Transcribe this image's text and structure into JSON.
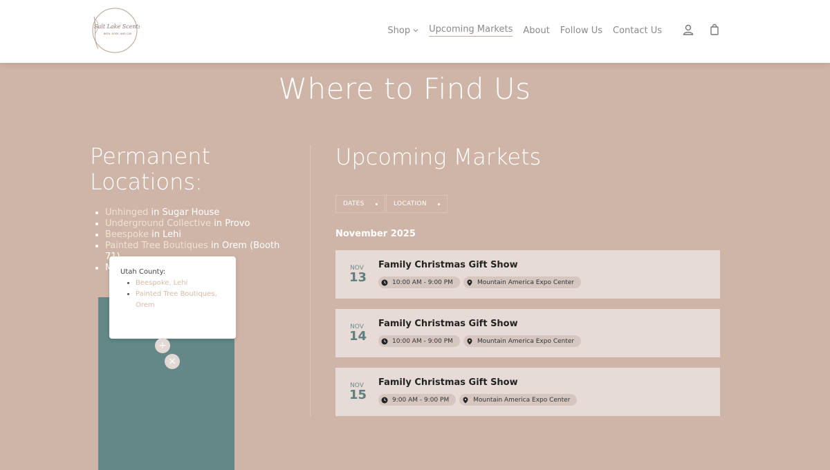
{
  "header": {
    "logo_text": "Salt Lake Scents",
    "logo_subtext": "BATH, BODY, AND CAR",
    "nav": [
      {
        "label": "Shop"
      },
      {
        "label": "Upcoming Markets"
      },
      {
        "label": "About"
      },
      {
        "label": "Follow Us"
      },
      {
        "label": "Contact Us"
      }
    ],
    "icons": [
      "account-icon",
      "shopping-bag-icon"
    ]
  },
  "page_title": "Where to Find Us",
  "permanent": {
    "heading": "Permanent Locations:",
    "locations": [
      {
        "store": "Unhinged",
        "joiner": " in ",
        "place": "Sugar House"
      },
      {
        "store": "Underground Collective",
        "joiner": " in ",
        "place": "Provo"
      },
      {
        "store": "Beespoke",
        "joiner": " in ",
        "place": "Lehi"
      },
      {
        "store": "Painted Tree Boutiques",
        "joiner": " in ",
        "place": "Orem (Booth 71)"
      },
      {
        "store": "M",
        "joiner": "",
        "place": ""
      }
    ]
  },
  "map": {
    "popup_title": "Utah County:",
    "popup_items": [
      "Beespoke, Lehi",
      "Painted Tree Boutiques, Orem"
    ],
    "zoom_in": "+",
    "close": "×",
    "color": "#638887"
  },
  "markets": {
    "heading": "Upcoming Markets",
    "filters": [
      "DATES",
      "LOCATION"
    ],
    "month": "November 2025",
    "events": [
      {
        "month": "NOV",
        "day": "13",
        "title": "Family Christmas Gift Show",
        "time": "10:00 AM - 9:00 PM",
        "location": "Mountain America Expo Center"
      },
      {
        "month": "NOV",
        "day": "14",
        "title": "Family Christmas Gift Show",
        "time": "10:00 AM - 9:00 PM",
        "location": "Mountain America Expo Center"
      },
      {
        "month": "NOV",
        "day": "15",
        "title": "Family Christmas Gift Show",
        "time": "9:00 AM - 9:00 PM",
        "location": "Mountain America Expo Center"
      }
    ]
  },
  "colors": {
    "background": "#cfb5a7",
    "card": "#e6dbd6",
    "accent": "#638887"
  }
}
